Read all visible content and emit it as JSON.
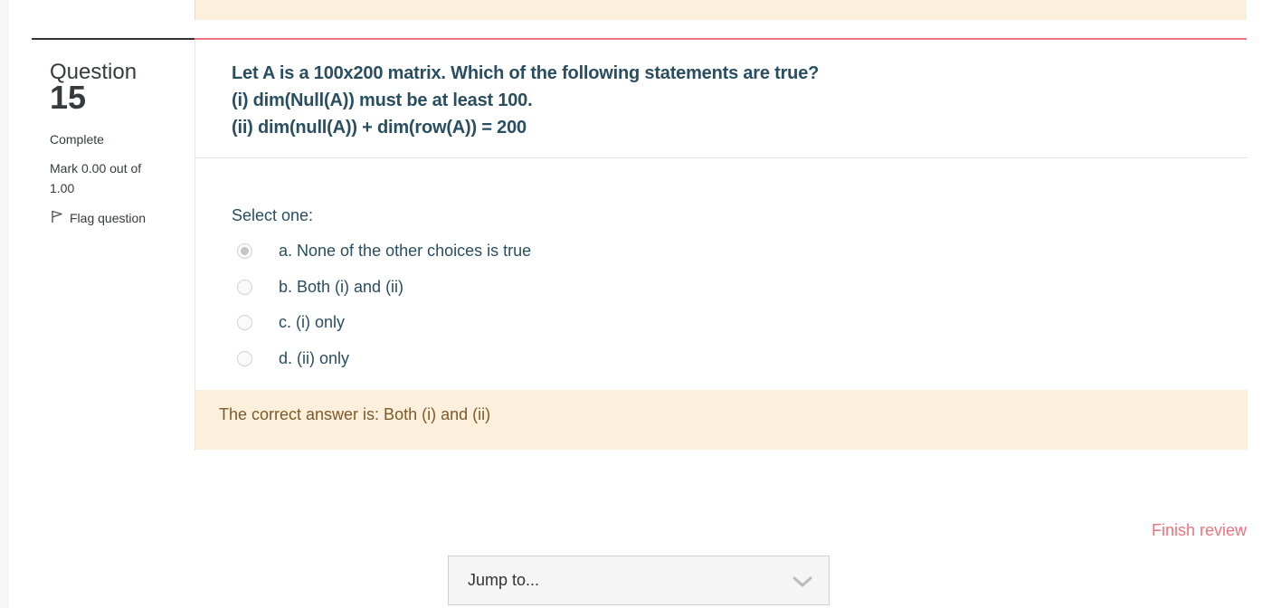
{
  "question": {
    "label": "Question",
    "number": "15",
    "state": "Complete",
    "grade": "Mark 0.00 out of 1.00",
    "flag_label": "Flag question",
    "text_line1": "Let A is a 100x200 matrix. Which of the following statements are true?",
    "text_line2": "(i) dim(Null(A)) must be at least 100.",
    "text_line3": "(ii) dim(null(A)) + dim(row(A)) = 200",
    "prompt": "Select one:",
    "answers": [
      {
        "label": "a. None of the other choices is true",
        "selected": true
      },
      {
        "label": "b. Both (i) and (ii)",
        "selected": false
      },
      {
        "label": "c. (i) only",
        "selected": false
      },
      {
        "label": "d. (ii) only",
        "selected": false
      }
    ],
    "feedback": "The correct answer is: Both (i) and (ii)"
  },
  "nav": {
    "finish_review": "Finish review",
    "jump_to": "Jump to..."
  },
  "colors": {
    "accent": "#f0717f",
    "question_text": "#2a4e61",
    "feedback_bg": "#fcefdc"
  },
  "icons": {
    "flag": "flag-icon",
    "dropdown": "chevron-down-icon"
  }
}
